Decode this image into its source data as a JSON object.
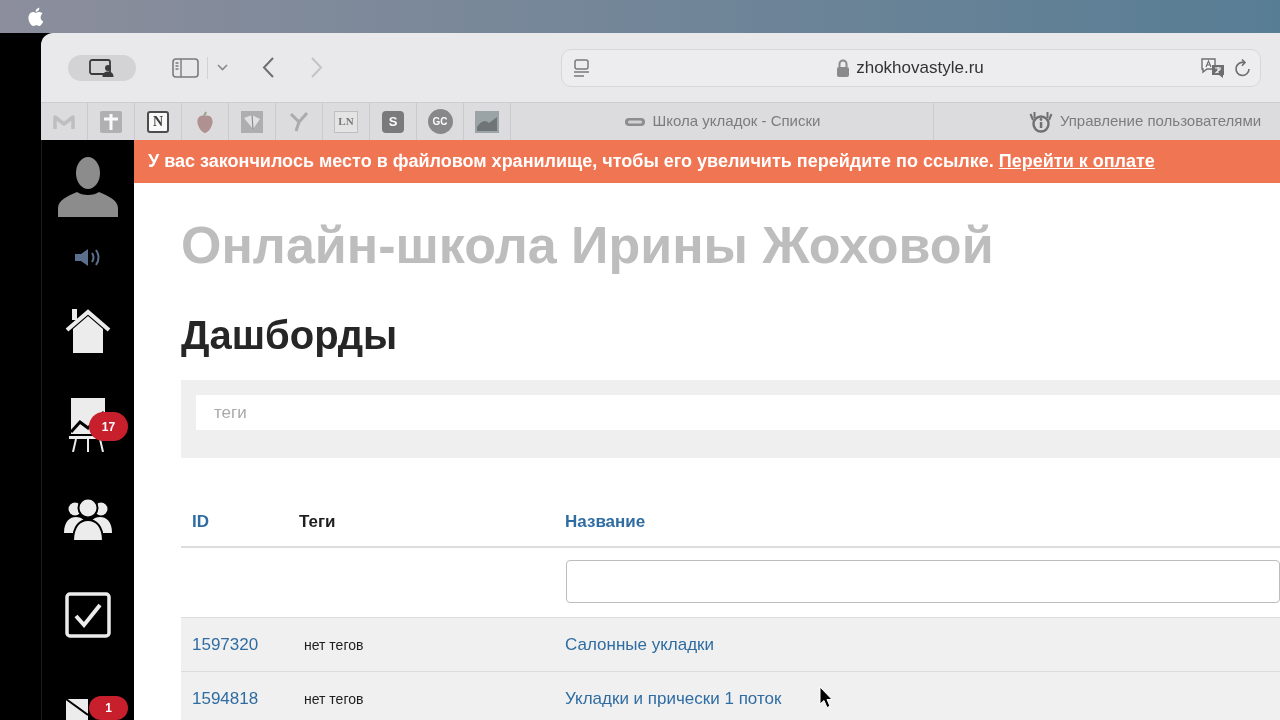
{
  "toolbar": {
    "back": {
      "disabled": false
    },
    "forward": {
      "disabled": true
    },
    "url": "zhokhovastyle.ru"
  },
  "pinned_tabs": [
    {
      "kind": "mail",
      "selected": false
    },
    {
      "kind": "cross",
      "selected": false
    },
    {
      "kind": "letter_box",
      "text": "N",
      "selected": false
    },
    {
      "kind": "fruit",
      "selected": false
    },
    {
      "kind": "book",
      "selected": false
    },
    {
      "kind": "y_mark",
      "selected": false
    },
    {
      "kind": "letter_tile",
      "text": "LN",
      "selected": false
    },
    {
      "kind": "letter_square",
      "text": "S",
      "selected": false
    },
    {
      "kind": "letter_circle",
      "text": "GC",
      "selected": false
    },
    {
      "kind": "picture",
      "selected": false
    }
  ],
  "tabs": [
    {
      "kind": "pill",
      "label": "Школа укладок - Списки",
      "selected": false
    },
    {
      "kind": "info",
      "label": "Управление пользователями",
      "selected": false
    }
  ],
  "sidebar": {
    "items": [
      {
        "kind": "avatar"
      },
      {
        "kind": "sound"
      },
      {
        "kind": "home"
      },
      {
        "kind": "chart",
        "badge": "17"
      },
      {
        "kind": "people"
      },
      {
        "kind": "tasks"
      },
      {
        "kind": "mail",
        "badge": "1"
      }
    ]
  },
  "banner": {
    "message": "У вас закончилось место в файловом хранилище, чтобы его увеличить перейдите по ссылке.",
    "link": "Перейти к оплате"
  },
  "school_name": "Онлайн-школа Ирины Жоховой",
  "page_title": "Дашборды",
  "tag_filter": {
    "placeholder": "теги"
  },
  "table": {
    "columns": [
      {
        "label": "ID",
        "kind": "link"
      },
      {
        "label": "Теги",
        "kind": "text"
      },
      {
        "label": "Название",
        "kind": "link"
      }
    ],
    "rows": [
      {
        "id": "1597320",
        "tags": "нет тегов",
        "name": "Салонные укладки"
      },
      {
        "id": "1594818",
        "tags": "нет тегов",
        "name": "Укладки и прически 1 поток"
      }
    ]
  }
}
